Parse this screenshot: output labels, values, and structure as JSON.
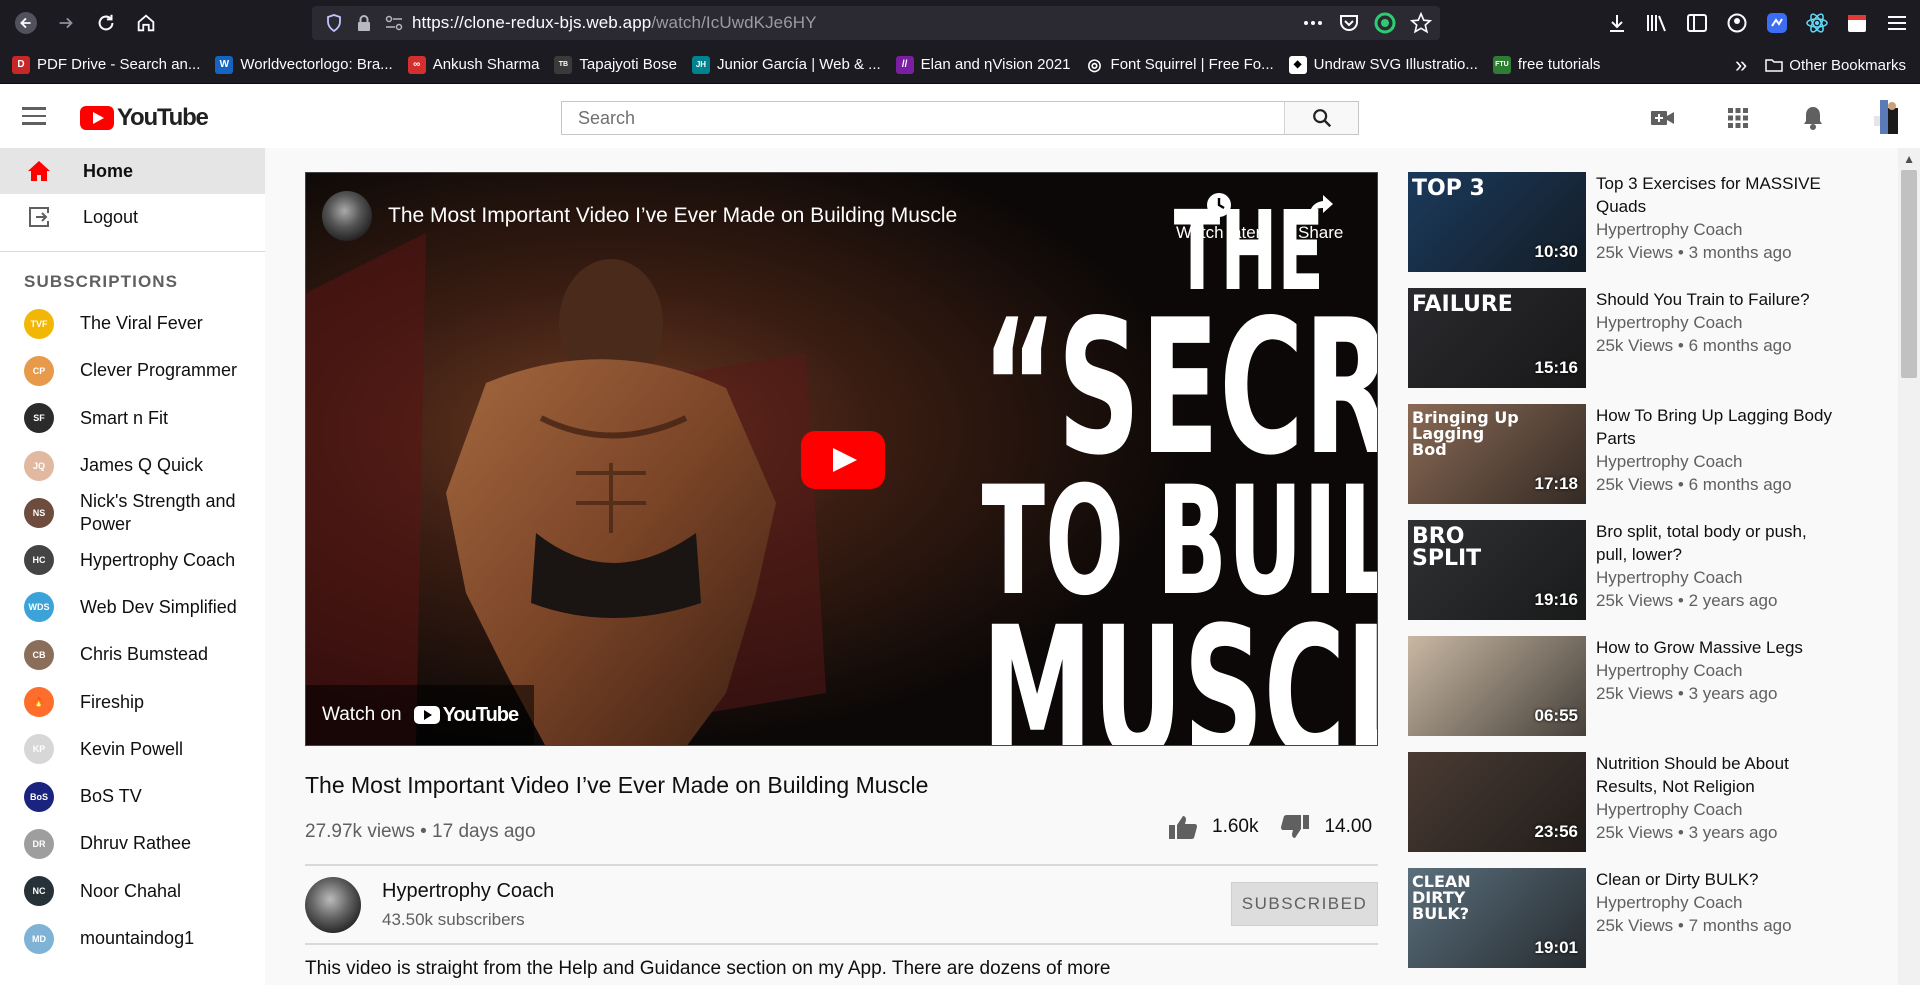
{
  "browser": {
    "url_main": "https://clone-redux-bjs.web.app",
    "url_path": "/watch/IcUwdKJe6HY",
    "bookmarks": [
      {
        "label": "PDF Drive - Search an...",
        "color": "#c62828",
        "icon_text": "D"
      },
      {
        "label": "Worldvectorlogo: Bra...",
        "color": "#1565c0",
        "icon_text": "W"
      },
      {
        "label": "Ankush Sharma",
        "color": "#d32f2f",
        "icon_text": "∞"
      },
      {
        "label": "Tapajyoti Bose",
        "color": "#3a3a3a",
        "icon_text": "TB"
      },
      {
        "label": "Junior García | Web & ...",
        "color": "#00838f",
        "icon_text": "JH"
      },
      {
        "label": "Elan and ηVision 2021",
        "color": "#7b1fa2",
        "icon_text": "//"
      },
      {
        "label": "Font Squirrel | Free Fo...",
        "color": "#555555",
        "icon_text": "◎"
      },
      {
        "label": "Undraw SVG Illustratio...",
        "color": "#ffffff",
        "icon_text": "◆"
      },
      {
        "label": "free tutorials",
        "color": "#2e7d32",
        "icon_text": "FTU"
      }
    ],
    "other_bookmarks": "Other Bookmarks"
  },
  "header": {
    "logo_text": "YouTube",
    "search_placeholder": "Search"
  },
  "sidebar": {
    "nav": [
      {
        "label": "Home",
        "icon": "home-icon"
      },
      {
        "label": "Logout",
        "icon": "logout-icon"
      }
    ],
    "subscriptions_heading": "SUBSCRIPTIONS",
    "subscriptions": [
      {
        "name": "The Viral Fever",
        "color": "#f2b705",
        "initials": "TVF"
      },
      {
        "name": "Clever Programmer",
        "color": "#e89a4b",
        "initials": "CP"
      },
      {
        "name": "Smart n Fit",
        "color": "#2b2b2b",
        "initials": "SF"
      },
      {
        "name": "James Q Quick",
        "color": "#e0b9a0",
        "initials": "JQ"
      },
      {
        "name": "Nick's Strength and Power",
        "color": "#6d4c3d",
        "initials": "NS"
      },
      {
        "name": "Hypertrophy Coach",
        "color": "#444444",
        "initials": "HC"
      },
      {
        "name": "Web Dev Simplified",
        "color": "#3ba3d8",
        "initials": "WDS"
      },
      {
        "name": "Chris Bumstead",
        "color": "#8a6e5a",
        "initials": "CB"
      },
      {
        "name": "Fireship",
        "color": "#ff6d2d",
        "initials": "🔥"
      },
      {
        "name": "Kevin Powell",
        "color": "#d7d7d7",
        "initials": "KP"
      },
      {
        "name": "BoS TV",
        "color": "#1a237e",
        "initials": "BoS"
      },
      {
        "name": "Dhruv Rathee",
        "color": "#9e9e9e",
        "initials": "DR"
      },
      {
        "name": "Noor Chahal",
        "color": "#263238",
        "initials": "NC"
      },
      {
        "name": "mountaindog1",
        "color": "#7fb3d5",
        "initials": "MD"
      }
    ]
  },
  "player": {
    "title": "The Most Important Video I’ve Ever Made on Building Muscle",
    "watch_later": "Watch later",
    "share": "Share",
    "thumb_line1": "THE",
    "thumb_line2": "“SECRET”",
    "thumb_line3": "TO BUILDING",
    "thumb_line4": "MUSCLE",
    "watch_on": "Watch on",
    "watch_on_brand": "YouTube"
  },
  "video": {
    "title": "The Most Important Video I’ve Ever Made on Building Muscle",
    "meta": "27.97k views • 17 days ago",
    "likes": "1.60k",
    "dislikes": "14.00",
    "channel_name": "Hypertrophy Coach",
    "channel_subs": "43.50k subscribers",
    "subscribe_label": "SUBSCRIBED",
    "description": "This video is straight from the Help and Guidance section on my App. There are dozens of more"
  },
  "recommendations": [
    {
      "title": "Top 3 Exercises for MASSIVE Quads",
      "channel": "Hypertrophy Coach",
      "stats": "25k Views • 3 months ago",
      "duration": "10:30",
      "thumb_text": "TOP 3",
      "thumb_bg": "#1b3a5c"
    },
    {
      "title": "Should You Train to Failure?",
      "channel": "Hypertrophy Coach",
      "stats": "25k Views • 6 months ago",
      "duration": "15:16",
      "thumb_text": "FAILURE",
      "thumb_bg": "#2a2a2e"
    },
    {
      "title": "How To Bring Up Lagging Body Parts",
      "channel": "Hypertrophy Coach",
      "stats": "25k Views • 6 months ago",
      "duration": "17:18",
      "thumb_text": "Bringing Up Lagging Bod",
      "thumb_bg": "#8a6a55"
    },
    {
      "title": "Bro split, total body or push, pull, lower?",
      "channel": "Hypertrophy Coach",
      "stats": "25k Views • 2 years ago",
      "duration": "19:16",
      "thumb_text": "BRO SPLIT",
      "thumb_bg": "#2f3133"
    },
    {
      "title": "How to Grow Massive Legs",
      "channel": "Hypertrophy Coach",
      "stats": "25k Views • 3 years ago",
      "duration": "06:55",
      "thumb_text": "",
      "thumb_bg": "#c9b8a3"
    },
    {
      "title": "Nutrition Should be About Results, Not Religion",
      "channel": "Hypertrophy Coach",
      "stats": "25k Views • 3 years ago",
      "duration": "23:56",
      "thumb_text": "",
      "thumb_bg": "#4a3b33"
    },
    {
      "title": "Clean or Dirty BULK?",
      "channel": "Hypertrophy Coach",
      "stats": "25k Views • 7 months ago",
      "duration": "19:01",
      "thumb_text": "CLEAN DIRTY BULK?",
      "thumb_bg": "#5b6f7d"
    }
  ]
}
